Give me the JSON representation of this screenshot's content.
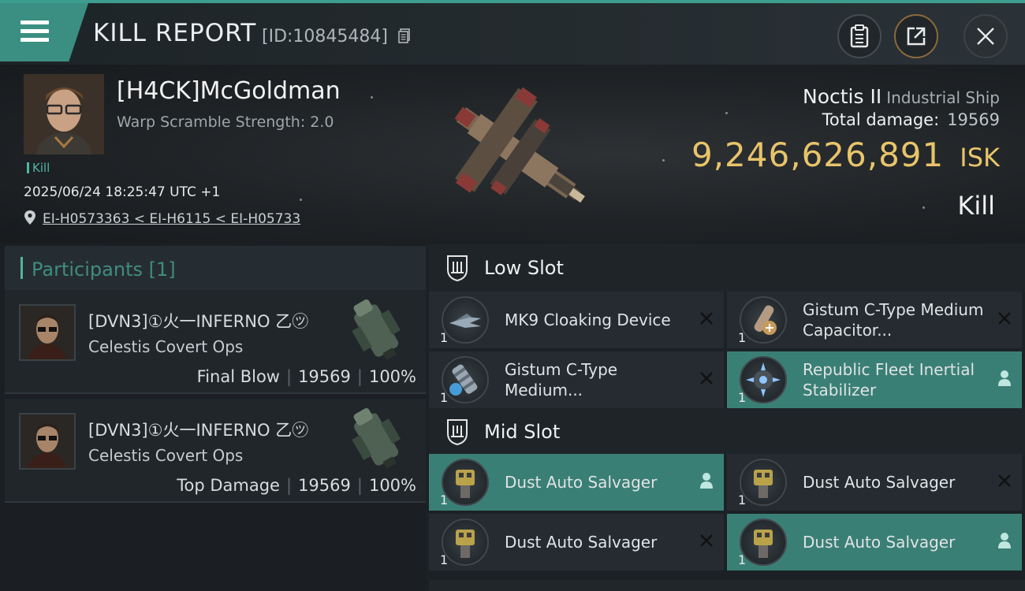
{
  "header": {
    "title": "KILL REPORT",
    "report_id": "[ID:10845484]"
  },
  "victim": {
    "name": "[H4CK]McGoldman",
    "warp_scramble": "Warp Scramble Strength: 2.0",
    "kill_tag": "Kill",
    "datetime": "2025/06/24 18:25:47 UTC +1",
    "location": "EI-H0573363 < EI-H6115 < EI-H05733"
  },
  "ship": {
    "name": "Noctis II",
    "class": "Industrial Ship",
    "total_damage_label": "Total damage:",
    "total_damage_value": "19569",
    "isk_value": "9,246,626,891",
    "isk_unit": "ISK",
    "result": "Kill"
  },
  "participants": {
    "title": "Participants [1]",
    "items": [
      {
        "name": "[DVN3]①火一INFERNO 乙㋡",
        "ship": "Celestis Covert Ops",
        "role": "Final Blow",
        "damage": "19569",
        "percent": "100%"
      },
      {
        "name": "[DVN3]①火一INFERNO 乙㋡",
        "ship": "Celestis Covert Ops",
        "role": "Top Damage",
        "damage": "19569",
        "percent": "100%"
      }
    ]
  },
  "slots": {
    "low_title": "Low Slot",
    "mid_title": "Mid Slot",
    "low": [
      {
        "name": "MK9 Cloaking Device",
        "qty": "1",
        "status": "destroyed",
        "icon": "cloak-icon"
      },
      {
        "name": "Gistum C-Type Medium Capacitor...",
        "qty": "1",
        "status": "destroyed",
        "icon": "capacitor-icon"
      },
      {
        "name": "Gistum C-Type Medium...",
        "qty": "1",
        "status": "destroyed",
        "icon": "shield-booster-icon"
      },
      {
        "name": "Republic Fleet Inertial Stabilizer",
        "qty": "1",
        "status": "dropped",
        "icon": "stabilizer-icon"
      }
    ],
    "mid": [
      {
        "name": "Dust Auto Salvager",
        "qty": "1",
        "status": "dropped",
        "icon": "salvager-icon"
      },
      {
        "name": "Dust Auto Salvager",
        "qty": "1",
        "status": "destroyed",
        "icon": "salvager-icon"
      },
      {
        "name": "Dust Auto Salvager",
        "qty": "1",
        "status": "destroyed",
        "icon": "salvager-icon"
      },
      {
        "name": "Dust Auto Salvager",
        "qty": "1",
        "status": "dropped",
        "icon": "salvager-icon"
      }
    ]
  },
  "colors": {
    "accent": "#3d9d8f",
    "isk_gold": "#e8c46a",
    "active_module": "#3a7f75"
  }
}
